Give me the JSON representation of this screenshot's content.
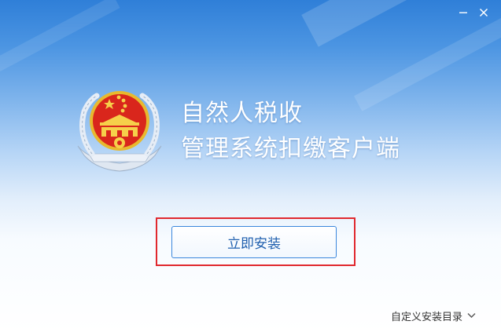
{
  "window": {
    "accent_color": "#2f7fd8",
    "controls": {
      "minimize_icon": "minimize-icon",
      "close_icon": "close-icon"
    }
  },
  "emblem": {
    "icon": "national-emblem-icon"
  },
  "title": {
    "line1": "自然人税收",
    "line2": "管理系统扣缴客户端"
  },
  "install": {
    "button_label": "立即安装",
    "highlight_color": "#e0282e"
  },
  "options": {
    "custom_dir_label": "自定义安装目录",
    "custom_dir_icon": "chevron-down-icon"
  }
}
